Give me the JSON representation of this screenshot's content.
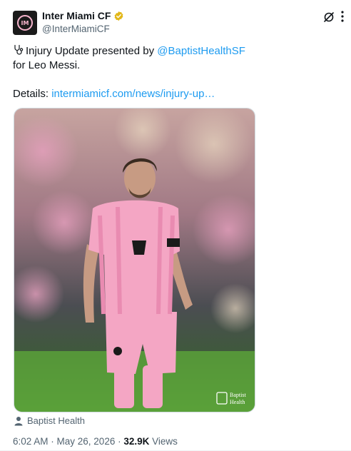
{
  "author": {
    "display_name": "Inter Miami CF",
    "handle": "@InterMiamiCF",
    "avatar_text": "IM",
    "verified_badge_color": "#e2b719"
  },
  "tweet": {
    "line1_prefix": "Injury Update presented by ",
    "mention": "@BaptistHealthSF",
    "line2": "for Leo Messi.",
    "details_label": "Details: ",
    "details_link": "intermiamicf.com/news/injury-up…",
    "emoji_icon": "stethoscope-icon"
  },
  "media": {
    "watermark_line1": "Baptist",
    "watermark_line2": "Health"
  },
  "attribution": {
    "label": "Baptist Health",
    "icon": "person-icon"
  },
  "meta": {
    "timestamp": "6:02 AM · May 26, 2026 · ",
    "views_count": "32.9K",
    "views_label": " Views"
  },
  "colors": {
    "link": "#1d9bf0",
    "text": "#0f1419",
    "muted": "#536471",
    "jersey_pink": "#f4a6c4"
  }
}
